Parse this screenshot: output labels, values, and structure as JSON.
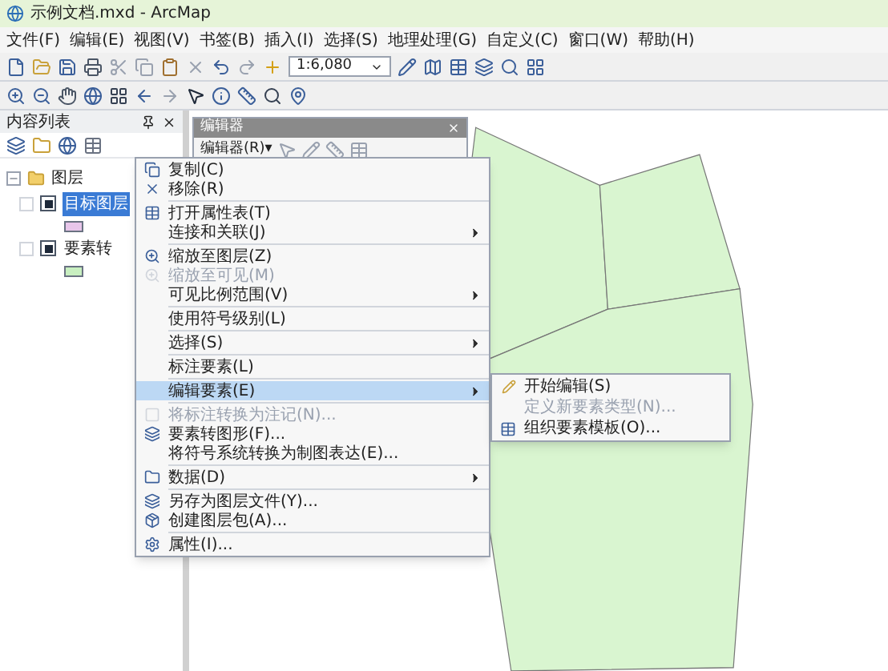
{
  "window": {
    "title": "示例文档.mxd - ArcMap"
  },
  "menubar": [
    "文件(F)",
    "编辑(E)",
    "视图(V)",
    "书签(B)",
    "插入(I)",
    "选择(S)",
    "地理处理(G)",
    "自定义(C)",
    "窗口(W)",
    "帮助(H)"
  ],
  "scale_field": {
    "value": "1:6,080"
  },
  "toc": {
    "title": "内容列表",
    "tree": [
      {
        "label": "图层",
        "expanded": true,
        "children": [
          {
            "label": "目标图层",
            "checked": true,
            "selected": true,
            "color": "#e8c6ea"
          },
          {
            "label": "要素转",
            "checked": true,
            "selected": false,
            "color": "#c8efc0"
          }
        ]
      }
    ]
  },
  "editor_toolbar": {
    "title": "编辑器",
    "menu": "编辑器(R)▾"
  },
  "context_menu": [
    {
      "label": "复制(C)",
      "disabled": false,
      "submenu": false,
      "selected": false,
      "separator_before": false
    },
    {
      "label": "移除(R)",
      "disabled": false,
      "submenu": false,
      "selected": false,
      "separator_before": false
    },
    {
      "label": "打开属性表(T)",
      "disabled": false,
      "submenu": false,
      "selected": false,
      "separator_before": true
    },
    {
      "label": "连接和关联(J)",
      "disabled": false,
      "submenu": true,
      "selected": false,
      "separator_before": false
    },
    {
      "label": "缩放至图层(Z)",
      "disabled": false,
      "submenu": false,
      "selected": false,
      "separator_before": true
    },
    {
      "label": "缩放至可见(M)",
      "disabled": true,
      "submenu": false,
      "selected": false,
      "separator_before": false
    },
    {
      "label": "可见比例范围(V)",
      "disabled": false,
      "submenu": true,
      "selected": false,
      "separator_before": false
    },
    {
      "label": "使用符号级别(L)",
      "disabled": false,
      "submenu": false,
      "selected": false,
      "separator_before": true
    },
    {
      "label": "选择(S)",
      "disabled": false,
      "submenu": true,
      "selected": false,
      "separator_before": true
    },
    {
      "label": "标注要素(L)",
      "disabled": false,
      "submenu": false,
      "selected": false,
      "separator_before": true
    },
    {
      "label": "编辑要素(E)",
      "disabled": false,
      "submenu": true,
      "selected": true,
      "separator_before": true
    },
    {
      "label": "将标注转换为注记(N)...",
      "disabled": true,
      "submenu": false,
      "selected": false,
      "separator_before": true
    },
    {
      "label": "要素转图形(F)...",
      "disabled": false,
      "submenu": false,
      "selected": false,
      "separator_before": false
    },
    {
      "label": "将符号系统转换为制图表达(E)...",
      "disabled": false,
      "submenu": false,
      "selected": false,
      "separator_before": false
    },
    {
      "label": "数据(D)",
      "disabled": false,
      "submenu": true,
      "selected": false,
      "separator_before": true
    },
    {
      "label": "另存为图层文件(Y)...",
      "disabled": false,
      "submenu": false,
      "selected": false,
      "separator_before": true
    },
    {
      "label": "创建图层包(A)...",
      "disabled": false,
      "submenu": false,
      "selected": false,
      "separator_before": false
    },
    {
      "label": "属性(I)...",
      "disabled": false,
      "submenu": false,
      "selected": false,
      "separator_before": true
    }
  ],
  "submenu": [
    {
      "label": "开始编辑(S)",
      "disabled": false
    },
    {
      "label": "定义新要素类型(N)...",
      "disabled": true
    },
    {
      "label": "组织要素模板(O)...",
      "disabled": false
    }
  ]
}
